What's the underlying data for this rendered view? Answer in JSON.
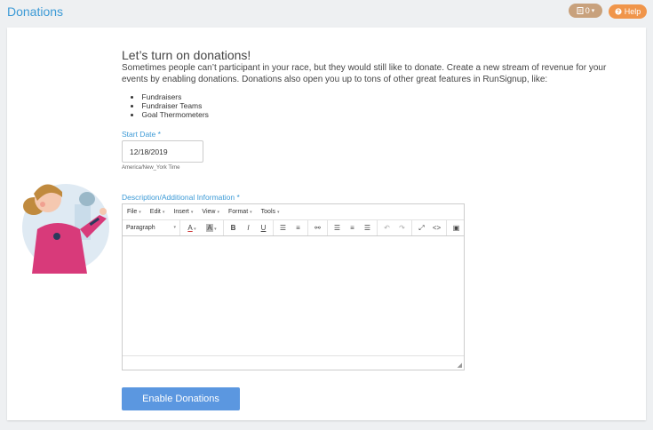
{
  "header": {
    "title": "Donations",
    "counter": {
      "icon": "notepad-icon",
      "value": "0",
      "caret": "▾"
    },
    "help": {
      "icon": "help-circle-icon",
      "label": "Help"
    }
  },
  "content": {
    "heading": "Let’s turn on donations!",
    "intro": "Sometimes people can’t participant in your race, but they would still like to donate. Create a new stream of revenue for your events by enabling donations. Donations also open you up to tons of other great features in RunSignup, like:",
    "features": [
      "Fundraisers",
      "Fundraiser Teams",
      "Goal Thermometers"
    ]
  },
  "start_date": {
    "label": "Start Date *",
    "value": "12/18/2019",
    "timezone": "America/New_York Time"
  },
  "description": {
    "label": "Description/Additional Information *",
    "menu": [
      "File",
      "Edit",
      "Insert",
      "View",
      "Format",
      "Tools"
    ],
    "format_select": "Paragraph"
  },
  "actions": {
    "enable_label": "Enable Donations"
  },
  "colors": {
    "accent": "#3c9ad6",
    "button": "#5b97e0",
    "help": "#f0954a",
    "counter": "#c8a17c"
  }
}
